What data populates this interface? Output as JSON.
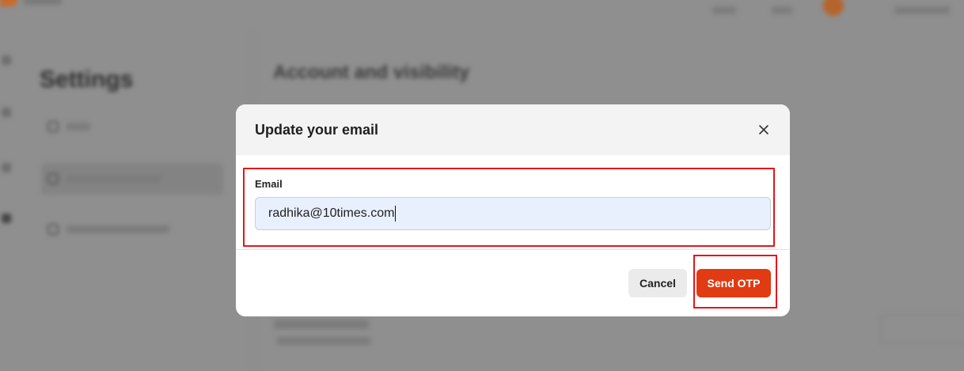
{
  "backdrop": {
    "settings_title": "Settings",
    "main_title": "Account and visibility"
  },
  "modal": {
    "title": "Update your email",
    "close_icon": "close-icon",
    "email_label": "Email",
    "email_value": "radhika@10times.com",
    "cancel_label": "Cancel",
    "send_label": "Send OTP"
  },
  "colors": {
    "accent": "#e03b12",
    "highlight": "#e5141b",
    "input_bg": "#e8f0fe"
  }
}
